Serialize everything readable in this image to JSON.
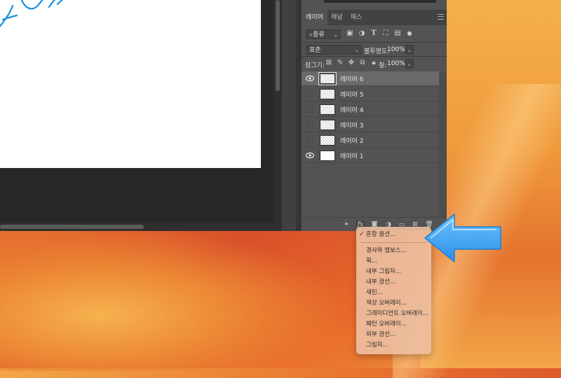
{
  "panel": {
    "tabs": [
      {
        "label": "레이어",
        "active": true
      },
      {
        "label": "채널",
        "active": false
      },
      {
        "label": "패스",
        "active": false
      }
    ],
    "filter": {
      "kind_label": "종류"
    },
    "blend_mode": "표준",
    "opacity_label": "불투명도:",
    "opacity_value": "100%",
    "lock_label": "잠그기:",
    "fill_label": "칠:",
    "fill_value": "100%",
    "layers": [
      {
        "name": "레이어 6",
        "visible": true,
        "selected": true
      },
      {
        "name": "레이어 5",
        "visible": false,
        "selected": false
      },
      {
        "name": "레이어 4",
        "visible": false,
        "selected": false
      },
      {
        "name": "레이어 3",
        "visible": false,
        "selected": false
      },
      {
        "name": "레이어 2",
        "visible": false,
        "selected": false
      },
      {
        "name": "레이어 1",
        "visible": true,
        "selected": false
      }
    ],
    "bottom_icons": [
      "link-icon",
      "fx-icon",
      "mask-icon",
      "adjustment-icon",
      "folder-icon",
      "new-layer-icon",
      "trash-icon"
    ],
    "fx_label": "fx"
  },
  "dropdown": {
    "checked": "혼합 옵션...",
    "items": [
      "경사와 엠보스...",
      "획...",
      "내부 그림자...",
      "내부 광선...",
      "새틴...",
      "색상 오버레이...",
      "그레이디언트 오버레이...",
      "패턴 오버레이...",
      "외부 광선...",
      "그림자..."
    ]
  },
  "canvas": {
    "stroke_color": "#1a8fe0"
  },
  "arrow": {
    "color": "#3fa9f5"
  }
}
